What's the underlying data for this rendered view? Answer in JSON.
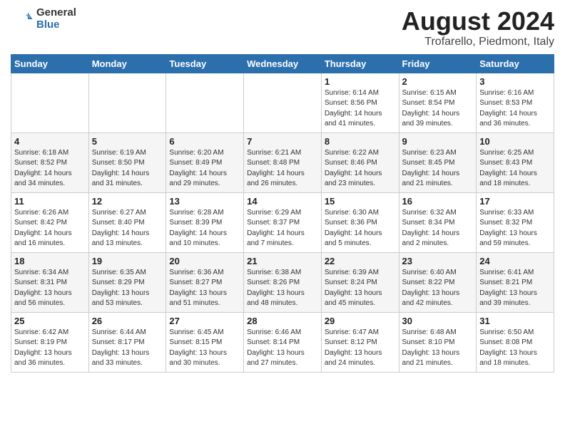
{
  "header": {
    "logo_general": "General",
    "logo_blue": "Blue",
    "title": "August 2024",
    "subtitle": "Trofarello, Piedmont, Italy"
  },
  "days_of_week": [
    "Sunday",
    "Monday",
    "Tuesday",
    "Wednesday",
    "Thursday",
    "Friday",
    "Saturday"
  ],
  "weeks": [
    [
      {
        "day": "",
        "info": ""
      },
      {
        "day": "",
        "info": ""
      },
      {
        "day": "",
        "info": ""
      },
      {
        "day": "",
        "info": ""
      },
      {
        "day": "1",
        "info": "Sunrise: 6:14 AM\nSunset: 8:56 PM\nDaylight: 14 hours\nand 41 minutes."
      },
      {
        "day": "2",
        "info": "Sunrise: 6:15 AM\nSunset: 8:54 PM\nDaylight: 14 hours\nand 39 minutes."
      },
      {
        "day": "3",
        "info": "Sunrise: 6:16 AM\nSunset: 8:53 PM\nDaylight: 14 hours\nand 36 minutes."
      }
    ],
    [
      {
        "day": "4",
        "info": "Sunrise: 6:18 AM\nSunset: 8:52 PM\nDaylight: 14 hours\nand 34 minutes."
      },
      {
        "day": "5",
        "info": "Sunrise: 6:19 AM\nSunset: 8:50 PM\nDaylight: 14 hours\nand 31 minutes."
      },
      {
        "day": "6",
        "info": "Sunrise: 6:20 AM\nSunset: 8:49 PM\nDaylight: 14 hours\nand 29 minutes."
      },
      {
        "day": "7",
        "info": "Sunrise: 6:21 AM\nSunset: 8:48 PM\nDaylight: 14 hours\nand 26 minutes."
      },
      {
        "day": "8",
        "info": "Sunrise: 6:22 AM\nSunset: 8:46 PM\nDaylight: 14 hours\nand 23 minutes."
      },
      {
        "day": "9",
        "info": "Sunrise: 6:23 AM\nSunset: 8:45 PM\nDaylight: 14 hours\nand 21 minutes."
      },
      {
        "day": "10",
        "info": "Sunrise: 6:25 AM\nSunset: 8:43 PM\nDaylight: 14 hours\nand 18 minutes."
      }
    ],
    [
      {
        "day": "11",
        "info": "Sunrise: 6:26 AM\nSunset: 8:42 PM\nDaylight: 14 hours\nand 16 minutes."
      },
      {
        "day": "12",
        "info": "Sunrise: 6:27 AM\nSunset: 8:40 PM\nDaylight: 14 hours\nand 13 minutes."
      },
      {
        "day": "13",
        "info": "Sunrise: 6:28 AM\nSunset: 8:39 PM\nDaylight: 14 hours\nand 10 minutes."
      },
      {
        "day": "14",
        "info": "Sunrise: 6:29 AM\nSunset: 8:37 PM\nDaylight: 14 hours\nand 7 minutes."
      },
      {
        "day": "15",
        "info": "Sunrise: 6:30 AM\nSunset: 8:36 PM\nDaylight: 14 hours\nand 5 minutes."
      },
      {
        "day": "16",
        "info": "Sunrise: 6:32 AM\nSunset: 8:34 PM\nDaylight: 14 hours\nand 2 minutes."
      },
      {
        "day": "17",
        "info": "Sunrise: 6:33 AM\nSunset: 8:32 PM\nDaylight: 13 hours\nand 59 minutes."
      }
    ],
    [
      {
        "day": "18",
        "info": "Sunrise: 6:34 AM\nSunset: 8:31 PM\nDaylight: 13 hours\nand 56 minutes."
      },
      {
        "day": "19",
        "info": "Sunrise: 6:35 AM\nSunset: 8:29 PM\nDaylight: 13 hours\nand 53 minutes."
      },
      {
        "day": "20",
        "info": "Sunrise: 6:36 AM\nSunset: 8:27 PM\nDaylight: 13 hours\nand 51 minutes."
      },
      {
        "day": "21",
        "info": "Sunrise: 6:38 AM\nSunset: 8:26 PM\nDaylight: 13 hours\nand 48 minutes."
      },
      {
        "day": "22",
        "info": "Sunrise: 6:39 AM\nSunset: 8:24 PM\nDaylight: 13 hours\nand 45 minutes."
      },
      {
        "day": "23",
        "info": "Sunrise: 6:40 AM\nSunset: 8:22 PM\nDaylight: 13 hours\nand 42 minutes."
      },
      {
        "day": "24",
        "info": "Sunrise: 6:41 AM\nSunset: 8:21 PM\nDaylight: 13 hours\nand 39 minutes."
      }
    ],
    [
      {
        "day": "25",
        "info": "Sunrise: 6:42 AM\nSunset: 8:19 PM\nDaylight: 13 hours\nand 36 minutes."
      },
      {
        "day": "26",
        "info": "Sunrise: 6:44 AM\nSunset: 8:17 PM\nDaylight: 13 hours\nand 33 minutes."
      },
      {
        "day": "27",
        "info": "Sunrise: 6:45 AM\nSunset: 8:15 PM\nDaylight: 13 hours\nand 30 minutes."
      },
      {
        "day": "28",
        "info": "Sunrise: 6:46 AM\nSunset: 8:14 PM\nDaylight: 13 hours\nand 27 minutes."
      },
      {
        "day": "29",
        "info": "Sunrise: 6:47 AM\nSunset: 8:12 PM\nDaylight: 13 hours\nand 24 minutes."
      },
      {
        "day": "30",
        "info": "Sunrise: 6:48 AM\nSunset: 8:10 PM\nDaylight: 13 hours\nand 21 minutes."
      },
      {
        "day": "31",
        "info": "Sunrise: 6:50 AM\nSunset: 8:08 PM\nDaylight: 13 hours\nand 18 minutes."
      }
    ]
  ]
}
